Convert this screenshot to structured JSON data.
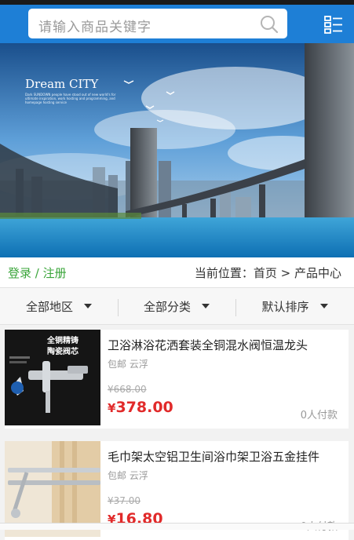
{
  "header": {
    "search_placeholder": "请输入商品关键字",
    "accent_color": "#1e7fd6"
  },
  "banner": {
    "title": "Dream CITY",
    "subtitle": "Dark SUNDOWN people have stood out of new world's for ultimate inspiration, work hosting and programming, and homepage hosting service"
  },
  "crumb": {
    "login_label": "登录 / 注册",
    "location_text": "当前位置：首页 > 产品中心"
  },
  "filters": [
    {
      "label": "全部地区"
    },
    {
      "label": "全部分类"
    },
    {
      "label": "默认排序"
    }
  ],
  "products": [
    {
      "name": "卫浴淋浴花洒套装全铜混水阀恒温龙头",
      "shipping": "包邮",
      "location": "云浮",
      "old_price": "¥668.00",
      "currency": "¥",
      "price": "378.00",
      "paid": "0人付款",
      "thumb_text_1": "全铜精铸",
      "thumb_text_2": "陶瓷阀芯"
    },
    {
      "name": "毛巾架太空铝卫生间浴巾架卫浴五金挂件",
      "shipping": "包邮",
      "location": "云浮",
      "old_price": "¥37.00",
      "currency": "¥",
      "price": "16.80",
      "paid": "0人付款"
    }
  ],
  "colors": {
    "price_red": "#e12a2a",
    "login_green": "#3aa53a"
  }
}
